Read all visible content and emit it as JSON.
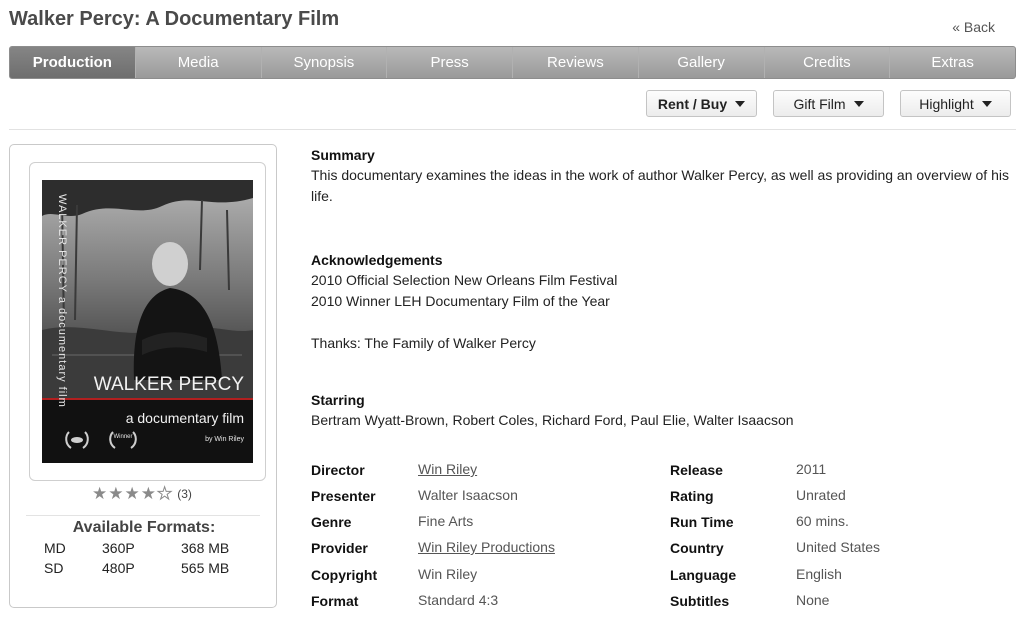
{
  "page": {
    "title": "Walker Percy: A Documentary Film",
    "back_label": "« Back"
  },
  "tabs": [
    {
      "label": "Production",
      "active": true
    },
    {
      "label": "Media"
    },
    {
      "label": "Synopsis"
    },
    {
      "label": "Press"
    },
    {
      "label": "Reviews"
    },
    {
      "label": "Gallery"
    },
    {
      "label": "Credits"
    },
    {
      "label": "Extras"
    }
  ],
  "actions": {
    "rent_buy": "Rent / Buy",
    "gift": "Gift Film",
    "highlight": "Highlight"
  },
  "poster": {
    "side_text": "WALKER PERCY a documentary film",
    "title": "WALKER PERCY",
    "subtitle": "a documentary film",
    "credit": "by Win Riley",
    "laurel_text": "Winner"
  },
  "rating": {
    "stars": 4,
    "max": 5,
    "count": "(3)"
  },
  "formats": {
    "title": "Available Formats:",
    "rows": [
      {
        "quality": "MD",
        "resolution": "360P",
        "size": "368 MB"
      },
      {
        "quality": "SD",
        "resolution": "480P",
        "size": "565 MB"
      }
    ]
  },
  "summary": {
    "heading": "Summary",
    "text": "This documentary examines the ideas in the work of author Walker Percy, as well as providing an overview of his life."
  },
  "acknowledgements": {
    "heading": "Acknowledgements",
    "lines": [
      "2010 Official Selection New Orleans Film Festival",
      "2010 Winner LEH Documentary Film of the Year",
      "Thanks: The Family of Walker Percy"
    ]
  },
  "starring": {
    "heading": "Starring",
    "text": "Bertram Wyatt-Brown, Robert Coles, Richard Ford, Paul Elie, Walter Isaacson"
  },
  "details_left": [
    {
      "label": "Director",
      "value": "Win Riley",
      "link": true
    },
    {
      "label": "Presenter",
      "value": "Walter Isaacson"
    },
    {
      "label": "Genre",
      "value": "Fine Arts"
    },
    {
      "label": "Provider",
      "value": "Win Riley Productions",
      "link": true
    },
    {
      "label": "Copyright",
      "value": "Win Riley"
    },
    {
      "label": "Format",
      "value": "Standard 4:3"
    }
  ],
  "details_right": [
    {
      "label": "Release",
      "value": "2011"
    },
    {
      "label": "Rating",
      "value": "Unrated"
    },
    {
      "label": "Run Time",
      "value": "60 mins."
    },
    {
      "label": "Country",
      "value": "United States"
    },
    {
      "label": "Language",
      "value": "English"
    },
    {
      "label": "Subtitles",
      "value": "None"
    }
  ]
}
